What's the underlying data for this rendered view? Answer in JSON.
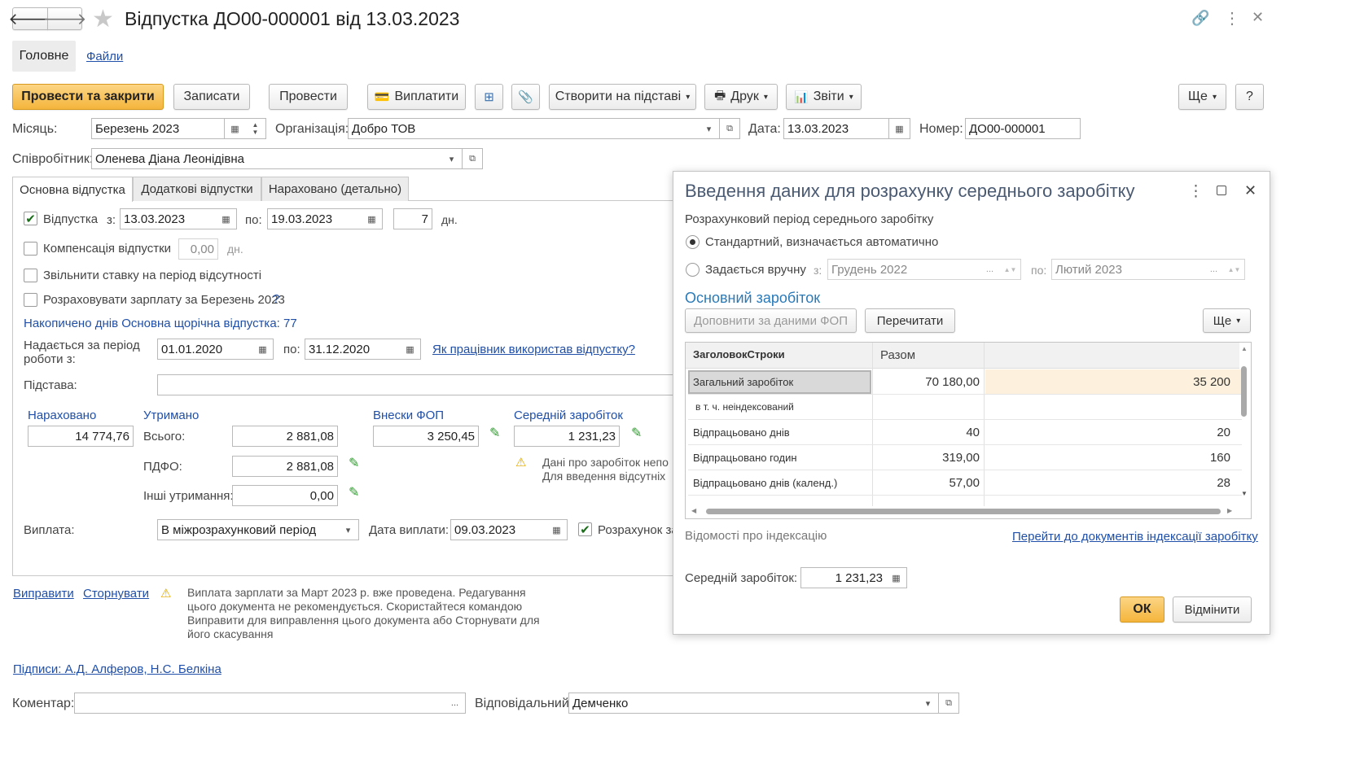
{
  "doc": {
    "title": "Відпустка ДО00-000001 від 13.03.2023",
    "tab_main": "Головне",
    "tab_files": "Файли"
  },
  "toolbar": {
    "post_close": "Провести та закрити",
    "save": "Записати",
    "post": "Провести",
    "pay": "Виплатити",
    "create_based": "Створити на підставі",
    "print": "Друк",
    "reports": "Звіти",
    "more": "Ще",
    "help": "?"
  },
  "header": {
    "month_label": "Місяць:",
    "month_value": "Березень 2023",
    "org_label": "Організація:",
    "org_value": "Добро ТОВ",
    "date_label": "Дата:",
    "date_value": "13.03.2023",
    "number_label": "Номер:",
    "number_value": "ДО00-000001",
    "employee_label": "Співробітник:",
    "employee_value": "Оленева Діана Леонідівна"
  },
  "tabs": [
    "Основна відпустка",
    "Додаткові відпустки",
    "Нараховано (детально)"
  ],
  "main": {
    "vacation_label": "Відпустка",
    "from_label": "з:",
    "from_value": "13.03.2023",
    "to_label": "по:",
    "to_value": "19.03.2023",
    "days_value": "7",
    "days_unit": "дн.",
    "comp_label": "Компенсація відпустки",
    "comp_value": "0,00",
    "comp_unit": "дн.",
    "release_rate_label": "Звільнити ставку на період відсутності",
    "calc_salary_label": "Розраховувати зарплату за Березень 2023",
    "calc_salary_q": "?",
    "accumulated": "Накопичено днів Основна щорічна відпустка: 77",
    "period_label_1": "Надається за період",
    "period_label_2": "роботи з:",
    "period_from": "01.01.2020",
    "period_to_label": "по:",
    "period_to": "31.12.2020",
    "period_link": "Як працівник використав відпустку?",
    "basis_label": "Підстава:",
    "accrued_title": "Нараховано",
    "accrued_value": "14 774,76",
    "withheld_title": "Утримано",
    "total_label": "Всього:",
    "total_value": "2 881,08",
    "pdfo_label": "ПДФО:",
    "pdfo_value": "2 881,08",
    "other_label": "Інші утримання:",
    "other_value": "0,00",
    "fop_title": "Внески ФОП",
    "fop_value": "3 250,45",
    "avg_title": "Середній заробіток",
    "avg_value": "1 231,23",
    "avg_warn_1": "Дані про заробіток непо",
    "avg_warn_2": "Для введення відсутніх",
    "payment_label": "Виплата:",
    "payment_value": "В міжрозрахунковий період",
    "pay_date_label": "Дата виплати:",
    "pay_date_value": "09.03.2023",
    "calc_label": "Розрахунок за"
  },
  "footer": {
    "fix_link": "Виправити",
    "storno_link": "Сторнувати",
    "warning_lines": [
      "Виплата зарплати за Март 2023 р. вже проведена. Редагування",
      "цього документа не рекомендується. Скористайтеся командою",
      "Виправити для виправлення цього документа або Сторнувати для",
      "його скасування"
    ],
    "signatures": "Підписи: А.Д. Алферов, Н.С. Белкіна",
    "comment_label": "Коментар:",
    "responsible_label": "Відповідальний:",
    "responsible_value": "Демченко"
  },
  "dialog": {
    "title": "Введення даних для розрахунку середнього заробітку",
    "period_title": "Розрахунковий період середнього заробітку",
    "opt_standard": "Стандартний, визначається автоматично",
    "opt_manual": "Задається вручну",
    "from_label": "з:",
    "from_value": "Грудень 2022",
    "to_label": "по:",
    "to_value": "Лютий 2023",
    "section": "Основний заробіток",
    "fill_btn": "Доповнити за даними ФОП",
    "reread_btn": "Перечитати",
    "more_btn": "Ще",
    "grid_headers": [
      "ЗаголовокСтроки",
      "Разом",
      ""
    ],
    "grid_rows": [
      {
        "name": "Загальний заробіток",
        "total": "70 180,00",
        "col3": "35 200"
      },
      {
        "name": "в т. ч. неіндексований",
        "total": "",
        "col3": ""
      },
      {
        "name": "Відпрацьовано днів",
        "total": "40",
        "col3": "20"
      },
      {
        "name": "Відпрацьовано годин",
        "total": "319,00",
        "col3": "160"
      },
      {
        "name": "Відпрацьовано днів (календ.)",
        "total": "57,00",
        "col3": "28"
      }
    ],
    "indexing_label": "Відомості про індексацію",
    "indexing_link": "Перейти до документів індексації заробітку",
    "avg_label": "Середній заробіток:",
    "avg_value": "1 231,23",
    "ok": "ОК",
    "cancel": "Відмінити"
  },
  "colors": {
    "accent_yellow": "#f4b53c",
    "link_blue": "#1f4fa8",
    "dialog_title": "#4a5a72",
    "selected_row": "#fdf1dd"
  }
}
